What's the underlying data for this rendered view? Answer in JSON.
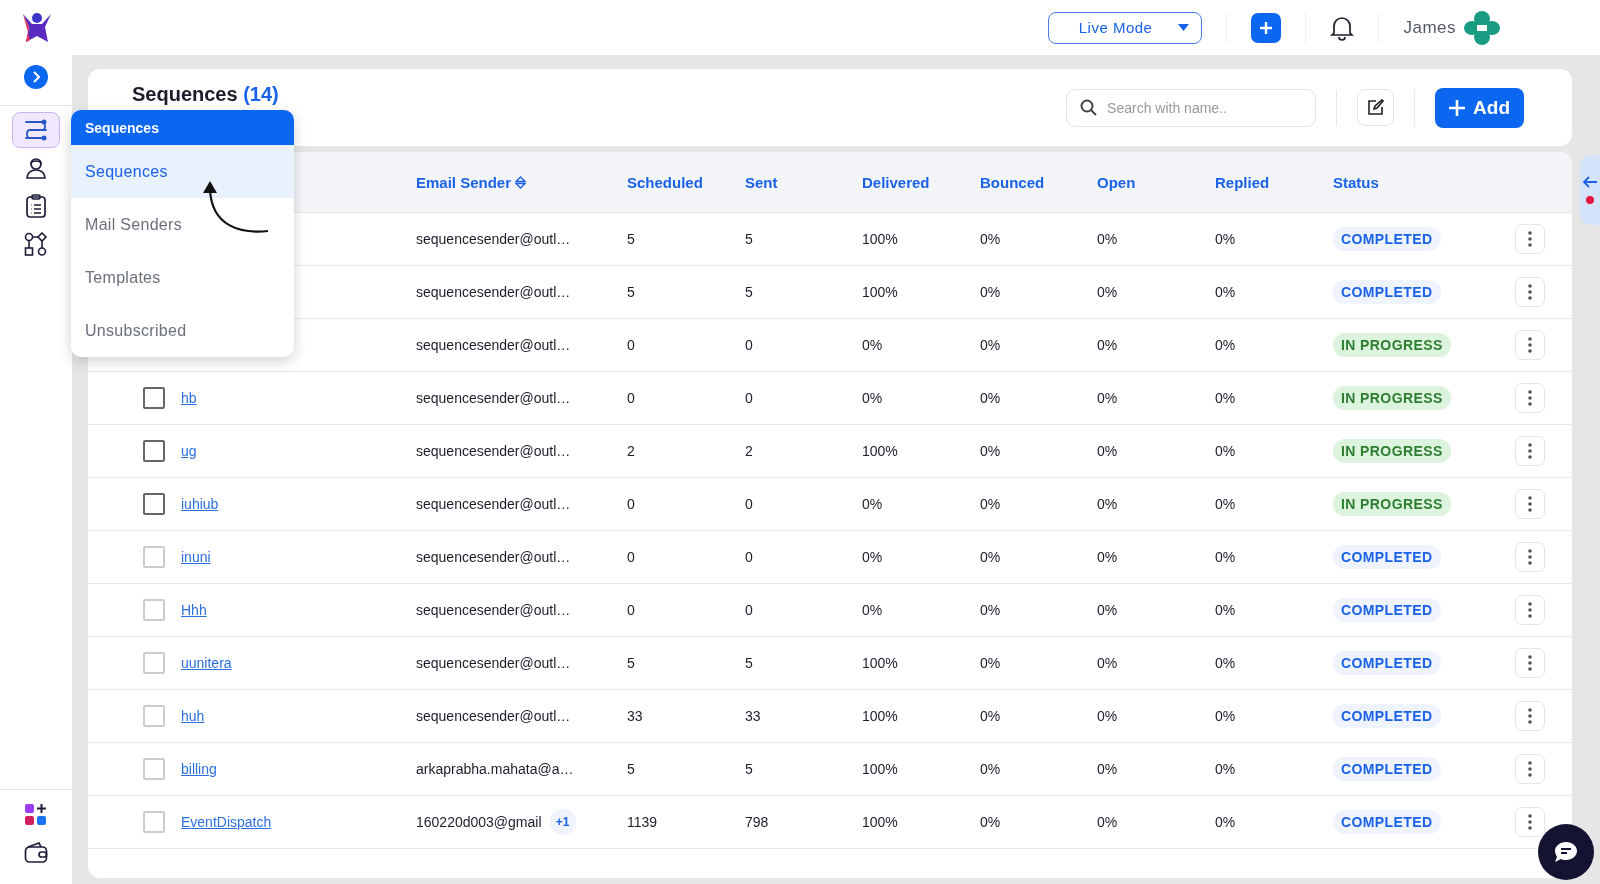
{
  "topbar": {
    "mode": {
      "label": "Live Mode"
    },
    "user": {
      "name": "James"
    }
  },
  "sidebar": {
    "items": [
      {
        "selected": true
      },
      {
        "selected": false
      },
      {
        "selected": false
      },
      {
        "selected": false
      }
    ]
  },
  "header": {
    "title": "Sequences",
    "count": "(14)",
    "search": {
      "placeholder": "Search with name.."
    },
    "add_button": "Add"
  },
  "menu": {
    "title": "Sequences",
    "items": [
      {
        "label": "Sequences",
        "selected": true
      },
      {
        "label": "Mail Senders",
        "selected": false
      },
      {
        "label": "Templates",
        "selected": false
      },
      {
        "label": "Unsubscribed",
        "selected": false
      }
    ]
  },
  "table": {
    "columns": [
      {
        "label": "Email Sender",
        "sortable": true
      },
      {
        "label": "Scheduled",
        "sortable": false
      },
      {
        "label": "Sent",
        "sortable": false
      },
      {
        "label": "Delivered",
        "sortable": false
      },
      {
        "label": "Bounced",
        "sortable": false
      },
      {
        "label": "Open",
        "sortable": false
      },
      {
        "label": "Replied",
        "sortable": false
      },
      {
        "label": "Status",
        "sortable": false
      }
    ],
    "rows": [
      {
        "cells": [
          "sequencesender@outl…",
          "5",
          "5",
          "100%",
          "0%",
          "0%",
          "0%"
        ],
        "status": {
          "label": "COMPLETED",
          "kind": "completed"
        }
      },
      {
        "cells": [
          "sequencesender@outl…",
          "5",
          "5",
          "100%",
          "0%",
          "0%",
          "0%"
        ],
        "status": {
          "label": "COMPLETED",
          "kind": "completed"
        }
      },
      {
        "cells": [
          "sequencesender@outl…",
          "0",
          "0",
          "0%",
          "0%",
          "0%",
          "0%"
        ],
        "status": {
          "label": "IN PROGRESS",
          "kind": "in_progress"
        }
      },
      {
        "checkbox": {
          "disabled": false
        },
        "name": "hb",
        "cells": [
          "sequencesender@outl…",
          "0",
          "0",
          "0%",
          "0%",
          "0%",
          "0%"
        ],
        "status": {
          "label": "IN PROGRESS",
          "kind": "in_progress"
        }
      },
      {
        "checkbox": {
          "disabled": false
        },
        "name": "ug",
        "cells": [
          "sequencesender@outl…",
          "2",
          "2",
          "100%",
          "0%",
          "0%",
          "0%"
        ],
        "status": {
          "label": "IN PROGRESS",
          "kind": "in_progress"
        }
      },
      {
        "checkbox": {
          "disabled": false
        },
        "name": "iuhiub",
        "cells": [
          "sequencesender@outl…",
          "0",
          "0",
          "0%",
          "0%",
          "0%",
          "0%"
        ],
        "status": {
          "label": "IN PROGRESS",
          "kind": "in_progress"
        }
      },
      {
        "checkbox": {
          "disabled": true
        },
        "name": "inuni",
        "cells": [
          "sequencesender@outl…",
          "0",
          "0",
          "0%",
          "0%",
          "0%",
          "0%"
        ],
        "status": {
          "label": "COMPLETED",
          "kind": "completed"
        }
      },
      {
        "checkbox": {
          "disabled": true
        },
        "name": "Hhh",
        "cells": [
          "sequencesender@outl…",
          "0",
          "0",
          "0%",
          "0%",
          "0%",
          "0%"
        ],
        "status": {
          "label": "COMPLETED",
          "kind": "completed"
        }
      },
      {
        "checkbox": {
          "disabled": true
        },
        "name": "uunitera",
        "cells": [
          "sequencesender@outl…",
          "5",
          "5",
          "100%",
          "0%",
          "0%",
          "0%"
        ],
        "status": {
          "label": "COMPLETED",
          "kind": "completed"
        }
      },
      {
        "checkbox": {
          "disabled": true
        },
        "name": "huh",
        "cells": [
          "sequencesender@outl…",
          "33",
          "33",
          "100%",
          "0%",
          "0%",
          "0%"
        ],
        "status": {
          "label": "COMPLETED",
          "kind": "completed"
        }
      },
      {
        "checkbox": {
          "disabled": true
        },
        "name": "billing",
        "cells": [
          "arkaprabha.mahata@a…",
          "5",
          "5",
          "100%",
          "0%",
          "0%",
          "0%"
        ],
        "status": {
          "label": "COMPLETED",
          "kind": "completed"
        }
      },
      {
        "checkbox": {
          "disabled": true
        },
        "name": "EventDispatch",
        "extra": "+1",
        "cells": [
          "160220d003@gmail",
          "1139",
          "798",
          "100%",
          "0%",
          "0%",
          "0%"
        ],
        "status": {
          "label": "COMPLETED",
          "kind": "completed"
        }
      }
    ]
  }
}
